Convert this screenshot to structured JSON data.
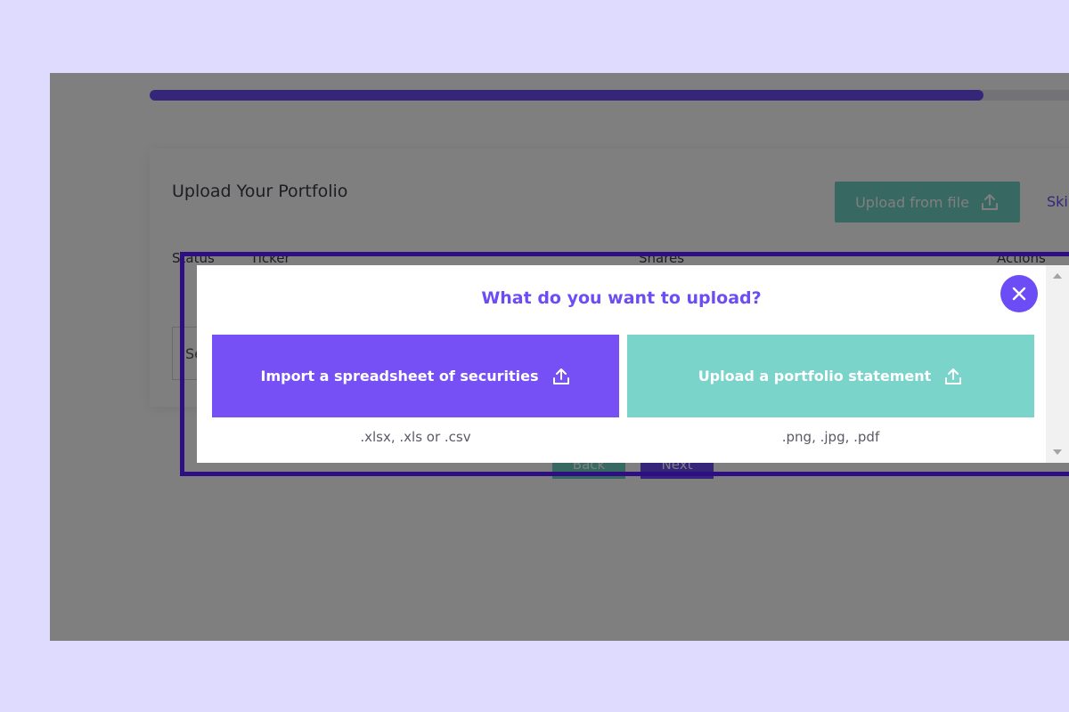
{
  "progress": {
    "value_percent": 90
  },
  "page": {
    "title": "Upload Your Portfolio",
    "upload_button": "Upload from file",
    "skip_link": "Skip",
    "table_headers": {
      "status": "Status",
      "ticker": "Ticker",
      "shares": "Shares",
      "actions": "Actions"
    },
    "search_placeholder": "Se",
    "back_button": "Back",
    "next_button": "Next"
  },
  "modal": {
    "title": "What do you want to upload?",
    "options": [
      {
        "label": "Import a spreadsheet of securities",
        "hint": ".xlsx, .xls or .csv",
        "icon": "upload-icon"
      },
      {
        "label": "Upload a portfolio statement",
        "hint": ".png, .jpg, .pdf",
        "icon": "upload-icon"
      }
    ],
    "close_icon": "close-icon"
  },
  "colors": {
    "brand_purple": "#6c4df5",
    "teal": "#7bd4ca",
    "backdrop": "#dedbff",
    "highlight_frame": "#2e0f82"
  }
}
